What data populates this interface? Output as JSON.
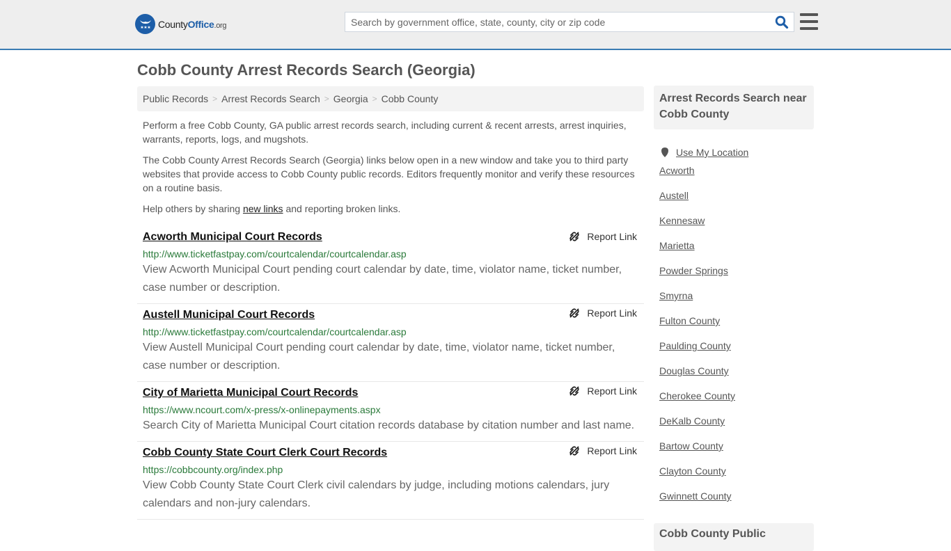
{
  "header": {
    "logo": {
      "name_part1": "County",
      "name_part2": "Office",
      "suffix": ".org"
    },
    "search": {
      "placeholder": "Search by government office, state, county, city or zip code",
      "value": ""
    },
    "brand_color": "#1d5ea8",
    "accent_border_color": "#3a7cb3"
  },
  "page": {
    "title": "Cobb County Arrest Records Search (Georgia)"
  },
  "breadcrumb": [
    {
      "label": "Public Records"
    },
    {
      "label": "Arrest Records Search"
    },
    {
      "label": "Georgia"
    },
    {
      "label": "Cobb County"
    }
  ],
  "breadcrumb_separator": ">",
  "intro": {
    "p1": "Perform a free Cobb County, GA public arrest records search, including current & recent arrests, arrest inquiries, warrants, reports, logs, and mugshots.",
    "p2": "The Cobb County Arrest Records Search (Georgia) links below open in a new window and take you to third party websites that provide access to Cobb County public records. Editors frequently monitor and verify these resources on a routine basis.",
    "p3_before": "Help others by sharing ",
    "p3_link": "new links",
    "p3_after": " and reporting broken links."
  },
  "report_label": "Report Link",
  "results": [
    {
      "title": "Acworth Municipal Court Records",
      "url": "http://www.ticketfastpay.com/courtcalendar/courtcalendar.asp",
      "description": "View Acworth Municipal Court pending court calendar by date, time, violator name, ticket number, case number or description."
    },
    {
      "title": "Austell Municipal Court Records",
      "url": "http://www.ticketfastpay.com/courtcalendar/courtcalendar.asp",
      "description": "View Austell Municipal Court pending court calendar by date, time, violator name, ticket number, case number or description."
    },
    {
      "title": "City of Marietta Municipal Court Records",
      "url": "https://www.ncourt.com/x-press/x-onlinepayments.aspx",
      "description": "Search City of Marietta Municipal Court citation records database by citation number and last name."
    },
    {
      "title": "Cobb County State Court Clerk Court Records",
      "url": "https://cobbcounty.org/index.php",
      "description": "View Cobb County State Court Clerk civil calendars by judge, including motions calendars, jury calendars and non-jury calendars."
    }
  ],
  "sidebar": {
    "heading": "Arrest Records Search near Cobb County",
    "use_location": "Use My Location",
    "links": [
      "Acworth",
      "Austell",
      "Kennesaw",
      "Marietta",
      "Powder Springs",
      "Smyrna",
      "Fulton County",
      "Paulding County",
      "Douglas County",
      "Cherokee County",
      "DeKalb County",
      "Bartow County",
      "Clayton County",
      "Gwinnett County"
    ],
    "heading2": "Cobb County Public"
  }
}
